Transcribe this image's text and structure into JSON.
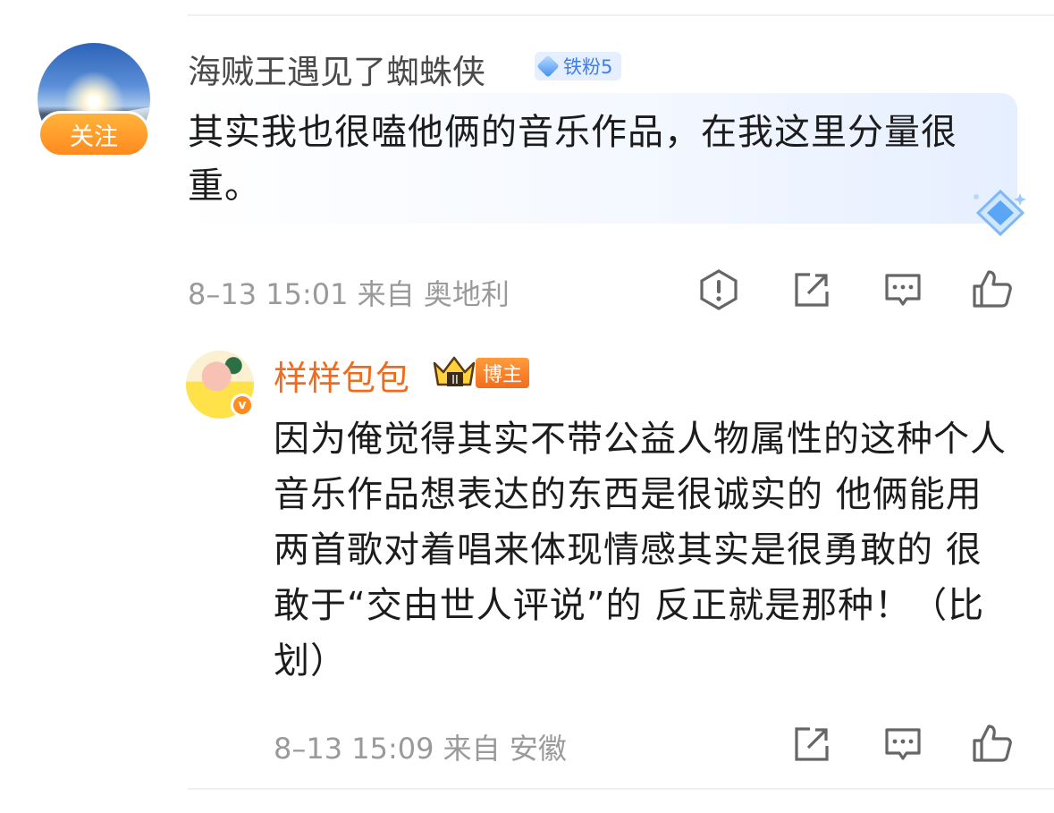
{
  "comment": {
    "username": "海贼王遇见了蜘蛛侠",
    "follow_label": "关注",
    "fan_badge": "铁粉5",
    "text": "其实我也很嗑他俩的音乐作品，在我这里分量很重。",
    "meta": "8–13 15:01 来自 奥地利",
    "icons": [
      "report-icon",
      "share-icon",
      "comment-icon",
      "like-icon"
    ]
  },
  "reply": {
    "username": "样样包包",
    "crown_level": "II",
    "host_badge": "博主",
    "verified_mark": "v",
    "text": "因为俺觉得其实不带公益人物属性的这种个人音乐作品想表达的东西是很诚实的 他俩能用两首歌对着唱来体现情感其实是很勇敢的 很敢于“交由世人评说”的 反正就是那种！（比划）",
    "meta": "8–13 15:09 来自 安徽",
    "icons": [
      "share-icon",
      "comment-icon",
      "like-icon"
    ]
  },
  "colors": {
    "accent_orange": "#f26b1d",
    "fan_badge_blue": "#3f7ee8",
    "meta_gray": "#9a9a9a"
  }
}
